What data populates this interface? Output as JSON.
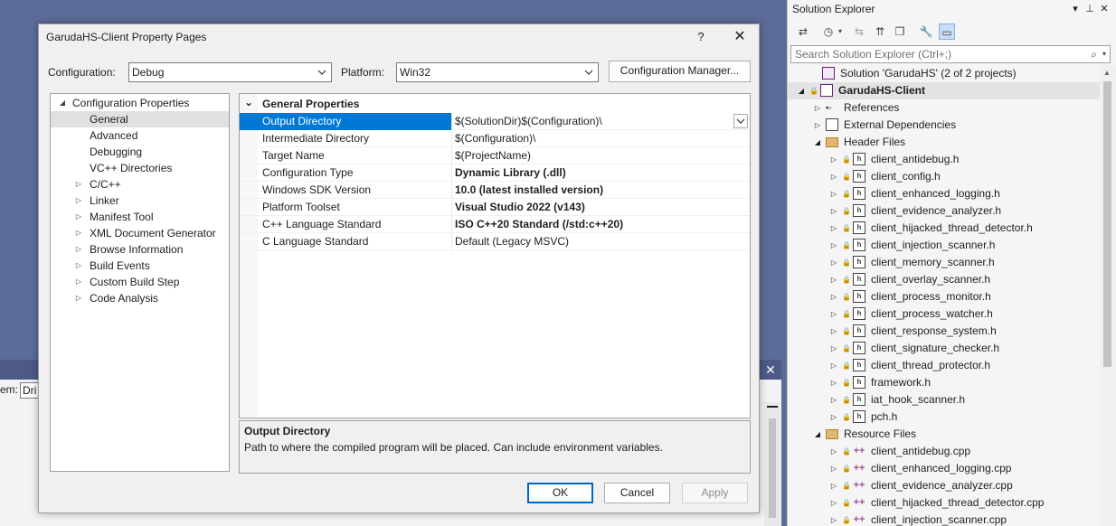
{
  "background": {
    "fragment_label": "em:",
    "fragment_input": "Dri",
    "close_glyph": "✕"
  },
  "dialog": {
    "title": "GarudaHS-Client Property Pages",
    "help": "?",
    "close": "✕",
    "configuration_label": "Configuration:",
    "configuration_value": "Debug",
    "platform_label": "Platform:",
    "platform_value": "Win32",
    "config_manager": "Configuration Manager...",
    "tree": [
      {
        "label": "Configuration Properties",
        "expander": "◢",
        "level": 0
      },
      {
        "label": "General",
        "expander": "",
        "level": 1,
        "selected": true
      },
      {
        "label": "Advanced",
        "expander": "",
        "level": 1
      },
      {
        "label": "Debugging",
        "expander": "",
        "level": 1
      },
      {
        "label": "VC++ Directories",
        "expander": "",
        "level": 1
      },
      {
        "label": "C/C++",
        "expander": "▷",
        "level": 1
      },
      {
        "label": "Linker",
        "expander": "▷",
        "level": 1
      },
      {
        "label": "Manifest Tool",
        "expander": "▷",
        "level": 1
      },
      {
        "label": "XML Document Generator",
        "expander": "▷",
        "level": 1
      },
      {
        "label": "Browse Information",
        "expander": "▷",
        "level": 1
      },
      {
        "label": "Build Events",
        "expander": "▷",
        "level": 1
      },
      {
        "label": "Custom Build Step",
        "expander": "▷",
        "level": 1
      },
      {
        "label": "Code Analysis",
        "expander": "▷",
        "level": 1
      }
    ],
    "grid": {
      "category": "General Properties",
      "category_expander": "⌄",
      "rows": [
        {
          "name": "Output Directory",
          "value": "$(SolutionDir)$(Configuration)\\",
          "bold": false,
          "selected": true
        },
        {
          "name": "Intermediate Directory",
          "value": "$(Configuration)\\",
          "bold": false
        },
        {
          "name": "Target Name",
          "value": "$(ProjectName)",
          "bold": false
        },
        {
          "name": "Configuration Type",
          "value": "Dynamic Library (.dll)",
          "bold": true
        },
        {
          "name": "Windows SDK Version",
          "value": "10.0 (latest installed version)",
          "bold": true
        },
        {
          "name": "Platform Toolset",
          "value": "Visual Studio 2022 (v143)",
          "bold": true
        },
        {
          "name": "C++ Language Standard",
          "value": "ISO C++20 Standard (/std:c++20)",
          "bold": true
        },
        {
          "name": "C Language Standard",
          "value": "Default (Legacy MSVC)",
          "bold": false
        }
      ]
    },
    "description": {
      "title": "Output Directory",
      "text": "Path to where the compiled program will be placed. Can include environment variables."
    },
    "buttons": {
      "ok": "OK",
      "cancel": "Cancel",
      "apply": "Apply"
    }
  },
  "solution_explorer": {
    "title": "Solution Explorer",
    "search_placeholder": "Search Solution Explorer (Ctrl+;)",
    "tree": [
      {
        "label": "Solution 'GarudaHS' (2 of 2 projects)",
        "level": 0,
        "expander": "",
        "icon": "solution",
        "lock": false
      },
      {
        "label": "GarudaHS-Client",
        "level": 0,
        "expander": "◢",
        "icon": "project",
        "lock": true,
        "bold": true,
        "selected": true
      },
      {
        "label": "References",
        "level": 1,
        "expander": "▷",
        "icon": "references",
        "lock": false
      },
      {
        "label": "External Dependencies",
        "level": 1,
        "expander": "▷",
        "icon": "external",
        "lock": false
      },
      {
        "label": "Header Files",
        "level": 1,
        "expander": "◢",
        "icon": "folder",
        "lock": false
      },
      {
        "label": "client_antidebug.h",
        "level": 2,
        "expander": "▷",
        "icon": "h",
        "lock": true
      },
      {
        "label": "client_config.h",
        "level": 2,
        "expander": "▷",
        "icon": "h",
        "lock": true
      },
      {
        "label": "client_enhanced_logging.h",
        "level": 2,
        "expander": "▷",
        "icon": "h",
        "lock": true
      },
      {
        "label": "client_evidence_analyzer.h",
        "level": 2,
        "expander": "▷",
        "icon": "h",
        "lock": true
      },
      {
        "label": "client_hijacked_thread_detector.h",
        "level": 2,
        "expander": "▷",
        "icon": "h",
        "lock": true
      },
      {
        "label": "client_injection_scanner.h",
        "level": 2,
        "expander": "▷",
        "icon": "h",
        "lock": true
      },
      {
        "label": "client_memory_scanner.h",
        "level": 2,
        "expander": "▷",
        "icon": "h",
        "lock": true
      },
      {
        "label": "client_overlay_scanner.h",
        "level": 2,
        "expander": "▷",
        "icon": "h",
        "lock": true
      },
      {
        "label": "client_process_monitor.h",
        "level": 2,
        "expander": "▷",
        "icon": "h",
        "lock": true
      },
      {
        "label": "client_process_watcher.h",
        "level": 2,
        "expander": "▷",
        "icon": "h",
        "lock": true
      },
      {
        "label": "client_response_system.h",
        "level": 2,
        "expander": "▷",
        "icon": "h",
        "lock": true
      },
      {
        "label": "client_signature_checker.h",
        "level": 2,
        "expander": "▷",
        "icon": "h",
        "lock": true
      },
      {
        "label": "client_thread_protector.h",
        "level": 2,
        "expander": "▷",
        "icon": "h",
        "lock": true
      },
      {
        "label": "framework.h",
        "level": 2,
        "expander": "▷",
        "icon": "h",
        "lock": true
      },
      {
        "label": "iat_hook_scanner.h",
        "level": 2,
        "expander": "▷",
        "icon": "h",
        "lock": true
      },
      {
        "label": "pch.h",
        "level": 2,
        "expander": "▷",
        "icon": "h",
        "lock": true
      },
      {
        "label": "Resource Files",
        "level": 1,
        "expander": "◢",
        "icon": "folder",
        "lock": false
      },
      {
        "label": "client_antidebug.cpp",
        "level": 2,
        "expander": "▷",
        "icon": "cpp",
        "lock": true
      },
      {
        "label": "client_enhanced_logging.cpp",
        "level": 2,
        "expander": "▷",
        "icon": "cpp",
        "lock": true
      },
      {
        "label": "client_evidence_analyzer.cpp",
        "level": 2,
        "expander": "▷",
        "icon": "cpp",
        "lock": true
      },
      {
        "label": "client_hijacked_thread_detector.cpp",
        "level": 2,
        "expander": "▷",
        "icon": "cpp",
        "lock": true
      },
      {
        "label": "client_injection_scanner.cpp",
        "level": 2,
        "expander": "▷",
        "icon": "cpp",
        "lock": true
      }
    ]
  },
  "colors": {
    "ide_background": "#5d6b99",
    "selection": "#0078d4",
    "folder": "#dcb67a",
    "cpp_icon": "#9b4f96"
  }
}
